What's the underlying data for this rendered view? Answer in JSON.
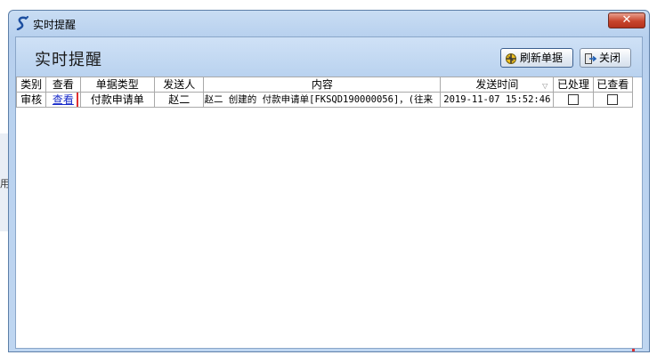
{
  "window": {
    "title": "实时提醒",
    "close_label": "✕"
  },
  "header": {
    "heading": "实时提醒",
    "refresh_label": "刷新单据",
    "close_label": "关闭"
  },
  "table": {
    "columns": [
      "类别",
      "查看",
      "单据类型",
      "发送人",
      "内容",
      "发送时间",
      "已处理",
      "已查看"
    ],
    "rows": [
      {
        "category": "审核",
        "view": "查看",
        "doc_type": "付款申请单",
        "sender": "赵二",
        "content": "赵二 创建的 付款申请单[FKSQD190000056]，(往来",
        "time": "2019-11-07 15:52:46",
        "processed": false,
        "viewed": false
      }
    ]
  },
  "background": {
    "fragment_text": "用"
  },
  "icons": {
    "app": "app-s-icon",
    "refresh": "refresh-icon",
    "exit": "exit-icon"
  }
}
